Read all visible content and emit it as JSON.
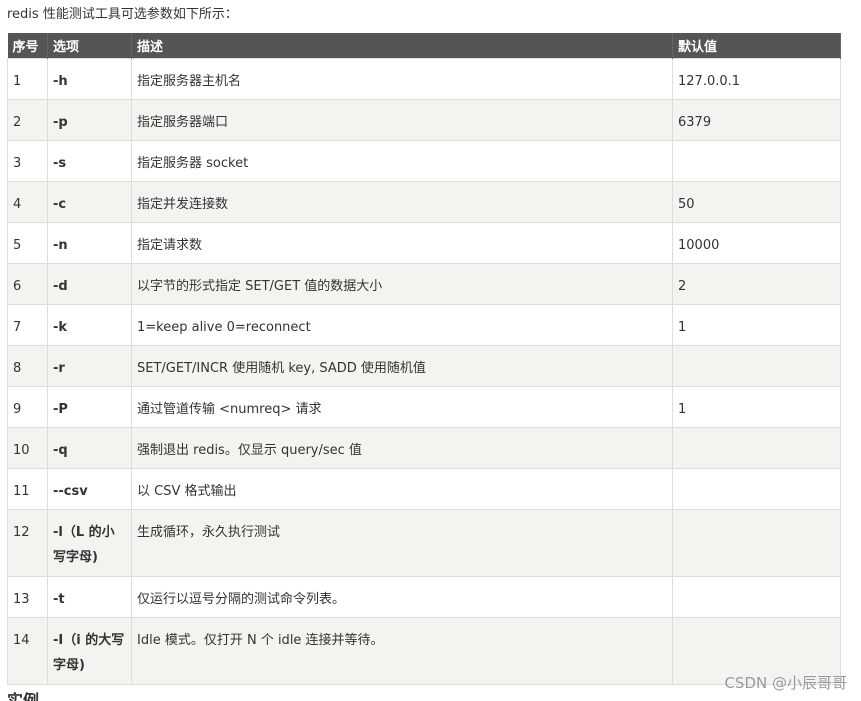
{
  "intro": "redis 性能测试工具可选参数如下所示：",
  "table": {
    "headers": [
      "序号",
      "选项",
      "描述",
      "默认值"
    ],
    "rows": [
      {
        "no": "1",
        "option": "-h",
        "desc": "指定服务器主机名",
        "default": "127.0.0.1"
      },
      {
        "no": "2",
        "option": "-p",
        "desc": "指定服务器端口",
        "default": "6379"
      },
      {
        "no": "3",
        "option": "-s",
        "desc": "指定服务器 socket",
        "default": ""
      },
      {
        "no": "4",
        "option": "-c",
        "desc": "指定并发连接数",
        "default": "50"
      },
      {
        "no": "5",
        "option": "-n",
        "desc": "指定请求数",
        "default": "10000"
      },
      {
        "no": "6",
        "option": "-d",
        "desc": "以字节的形式指定 SET/GET 值的数据大小",
        "default": "2"
      },
      {
        "no": "7",
        "option": "-k",
        "desc": "1=keep alive 0=reconnect",
        "default": "1"
      },
      {
        "no": "8",
        "option": "-r",
        "desc": "SET/GET/INCR 使用随机 key, SADD 使用随机值",
        "default": ""
      },
      {
        "no": "9",
        "option": "-P",
        "desc": "通过管道传输 <numreq> 请求",
        "default": "1"
      },
      {
        "no": "10",
        "option": "-q",
        "desc": "强制退出 redis。仅显示 query/sec 值",
        "default": ""
      },
      {
        "no": "11",
        "option": "--csv",
        "desc": "以 CSV 格式输出",
        "default": ""
      },
      {
        "no": "12",
        "option": "-l（L 的小写字母)",
        "desc": "生成循环，永久执行测试",
        "default": ""
      },
      {
        "no": "13",
        "option": "-t",
        "desc": "仅运行以逗号分隔的测试命令列表。",
        "default": ""
      },
      {
        "no": "14",
        "option": "-I（i 的大写字母)",
        "desc": "Idle 模式。仅打开 N 个 idle 连接并等待。",
        "default": ""
      }
    ]
  },
  "footer_heading": "实例",
  "watermark": "CSDN @小辰哥哥"
}
